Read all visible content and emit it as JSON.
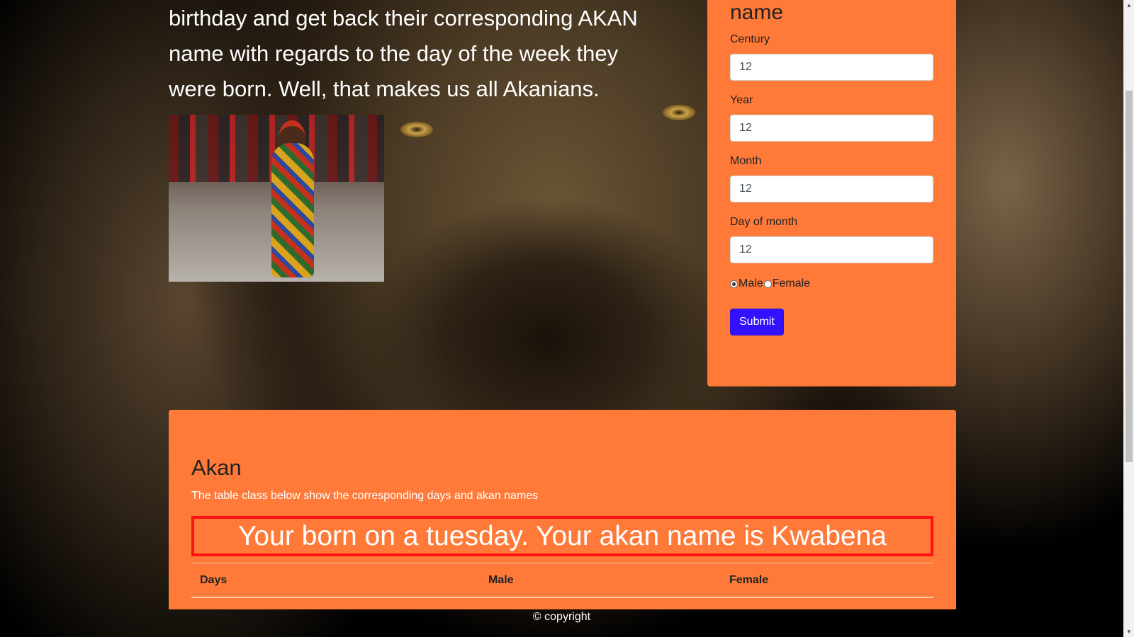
{
  "intro": {
    "lines": [
      "birthday and get back their corresponding AKAN",
      "name with regards to the day of the week they",
      "were born. Well, that makes us all Akanians."
    ]
  },
  "form": {
    "title": "name",
    "century_label": "Century",
    "century_value": "12",
    "year_label": "Year",
    "year_value": "12",
    "month_label": "Month",
    "month_value": "12",
    "day_label": "Day of month",
    "day_value": "12",
    "male_label": "Male",
    "female_label": "Female",
    "selected_gender": "Male",
    "submit_label": "Submit"
  },
  "akan": {
    "title": "Akan",
    "subtitle": "The table class below show the corresponding days and akan names",
    "result": "Your born on a tuesday. Your akan name is Kwabena",
    "table_headers": [
      "Days",
      "Male",
      "Female"
    ]
  },
  "footer": {
    "text": "© copyright"
  },
  "colors": {
    "card": "#ff7a39",
    "submit": "#3311ff",
    "result_border": "#ff1111"
  },
  "icons": {
    "scroll_up": "triangle-up-icon",
    "scroll_down": "triangle-down-icon"
  }
}
